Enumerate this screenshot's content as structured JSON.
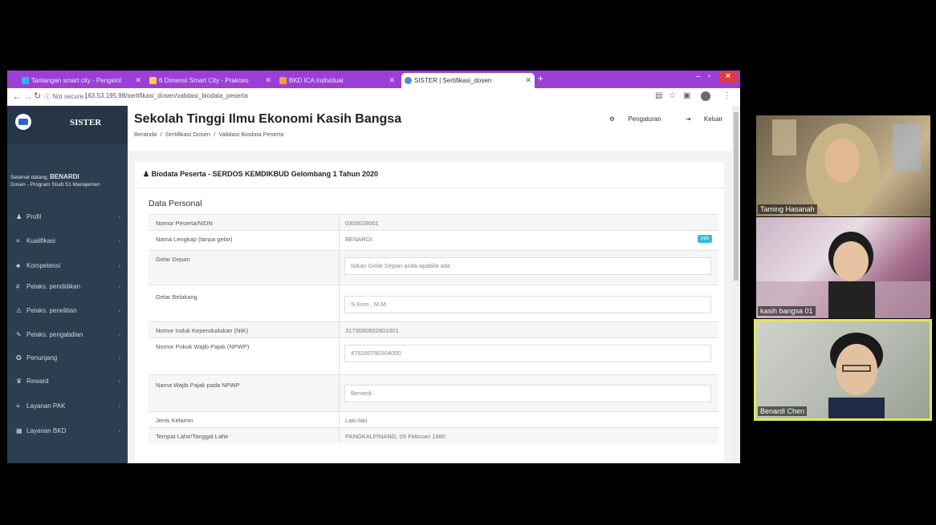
{
  "tabs": [
    {
      "label": "Tantangan smart city - Pengelol",
      "color": "#2fb5e6",
      "active": false
    },
    {
      "label": "6 Dimensi Smart City - Prakoso",
      "color": "#f4d24a",
      "active": false
    },
    {
      "label": "BKD ICA Individual",
      "color": "#f0a32c",
      "active": false
    },
    {
      "label": "SISTER | Sertifikasi_dosen",
      "color": "#4f8fd8",
      "active": true
    }
  ],
  "address_bar": {
    "security": "Not secure",
    "url": "163.53.195.98/sertifikasi_dosen/validasi_biodata_peserta"
  },
  "sidebar": {
    "brand": "SISTER",
    "welcome_prefix": "Selamat datang, ",
    "welcome_name": "BENARDI",
    "welcome_role": "Dosen - Program Studi S1 Manajemen",
    "items": [
      {
        "icon": "♟",
        "label": "Profil"
      },
      {
        "icon": "≡",
        "label": "Kualifikasi"
      },
      {
        "icon": "♣",
        "label": "Kompetensi"
      },
      {
        "icon": "#",
        "label": "Pelaks. pendidikan"
      },
      {
        "icon": "⚠",
        "label": "Pelaks. penelitian"
      },
      {
        "icon": "✎",
        "label": "Pelaks. pengabdian"
      },
      {
        "icon": "✪",
        "label": "Penunjang"
      },
      {
        "icon": "♛",
        "label": "Reward"
      },
      {
        "icon": "≡",
        "label": "Layanan PAK"
      },
      {
        "icon": "▦",
        "label": "Layanan BKD"
      }
    ]
  },
  "header": {
    "title": "Sekolah Tinggi Ilmu Ekonomi Kasih Bangsa",
    "breadcrumbs": [
      "Beranda",
      "Sertifikasi Dosen",
      "Validasi Biodata Peserta"
    ],
    "settings_label": "Pengaturan",
    "logout_label": "Keluar"
  },
  "card": {
    "title": "Biodata Peserta - SERDOS KEMDIKBUD Gelombang 1 Tahun 2020",
    "section": "Data Personal",
    "info_badge": "Info",
    "rows": [
      {
        "label": "Nomor Peserta/NIDN",
        "value": "0305028001",
        "input": false
      },
      {
        "label": "Nama Lengkap (tanpa gelar)",
        "value": "BENARDI",
        "input": false
      },
      {
        "label": "Gelar Depan",
        "value": "Isikan Gelar Depan anda apabila ada",
        "input": true
      },
      {
        "label": "Gelar Belakang",
        "value": "S.Kom., M.M.",
        "input": true
      },
      {
        "label": "Nomor Induk Kependudukan (NIK)",
        "value": "3173060502801001",
        "input": false
      },
      {
        "label": "Nomor Pokok Wajib Pajak (NPWP)",
        "value": "478280780304000",
        "input": true
      },
      {
        "label": "Nama Wajib Pajak pada NPWP",
        "value": "Benardi",
        "input": true
      },
      {
        "label": "Jenis Kelamin",
        "value": "Laki-laki",
        "input": false
      },
      {
        "label": "Tempat Lahir/Tanggal Lahir",
        "value": "PANGKALPINANG, 05 Februari 1980",
        "input": false
      }
    ]
  },
  "participants": [
    {
      "name": "Taming Hasanah",
      "active": false
    },
    {
      "name": "kasih bangsa 01",
      "active": false
    },
    {
      "name": "Benardi Chen",
      "active": true
    }
  ]
}
